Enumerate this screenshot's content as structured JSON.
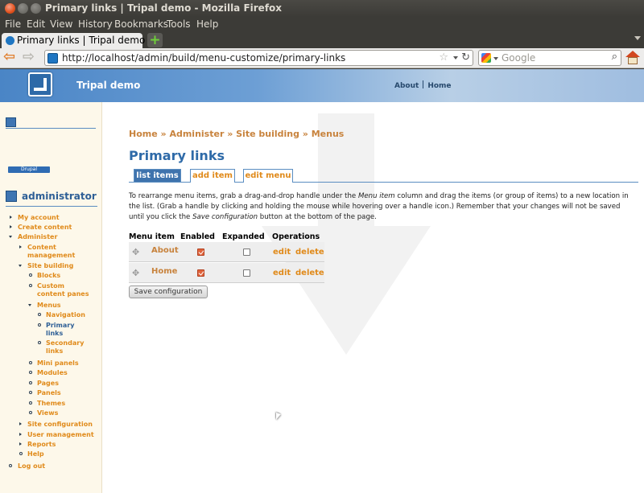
{
  "window": {
    "title": "Primary links | Tripal demo - Mozilla Firefox"
  },
  "menubar": [
    "File",
    "Edit",
    "View",
    "History",
    "Bookmarks",
    "Tools",
    "Help"
  ],
  "tab": {
    "title": "Primary links | Tripal demo",
    "new_tab": "+"
  },
  "navbar": {
    "url": "http://localhost/admin/build/menu-customize/primary-links",
    "search_placeholder": "Google"
  },
  "site": {
    "name": "Tripal demo",
    "primary_links": [
      "About",
      "Home"
    ]
  },
  "sidebar": {
    "drupal_badge": "Drupal",
    "username": "administrator",
    "items": [
      {
        "label": "My account"
      },
      {
        "label": "Create content"
      },
      {
        "label": "Administer"
      },
      {
        "label": "Content management"
      },
      {
        "label": "Site building"
      },
      {
        "label": "Blocks"
      },
      {
        "label": "Custom content panes"
      },
      {
        "label": "Menus"
      },
      {
        "label": "Navigation"
      },
      {
        "label": "Primary links"
      },
      {
        "label": "Secondary links"
      },
      {
        "label": "Mini panels"
      },
      {
        "label": "Modules"
      },
      {
        "label": "Pages"
      },
      {
        "label": "Panels"
      },
      {
        "label": "Themes"
      },
      {
        "label": "Views"
      },
      {
        "label": "Site configuration"
      },
      {
        "label": "User management"
      },
      {
        "label": "Reports"
      },
      {
        "label": "Help"
      },
      {
        "label": "Log out"
      }
    ]
  },
  "main": {
    "breadcrumb": "Home » Administer » Site building » Menus",
    "title": "Primary links",
    "tabs": [
      "list items",
      "add item",
      "edit menu"
    ],
    "help_1": "To rearrange menu items, grab a drag-and-drop handle under the ",
    "help_em1": "Menu item",
    "help_2": " column and drag the items (or group of items) to a new location in the list. (Grab a handle by clicking and holding the mouse while hovering over a handle icon.) Remember that your changes will not be saved until you click the ",
    "help_em2": "Save configuration",
    "help_3": " button at the bottom of the page.",
    "table": {
      "headers": [
        "Menu item",
        "Enabled",
        "Expanded",
        "Operations"
      ],
      "rows": [
        {
          "item": "About",
          "enabled": true,
          "expanded": false,
          "edit": "edit",
          "delete": "delete"
        },
        {
          "item": "Home",
          "enabled": true,
          "expanded": false,
          "edit": "edit",
          "delete": "delete"
        }
      ]
    },
    "save_button": "Save configuration"
  }
}
